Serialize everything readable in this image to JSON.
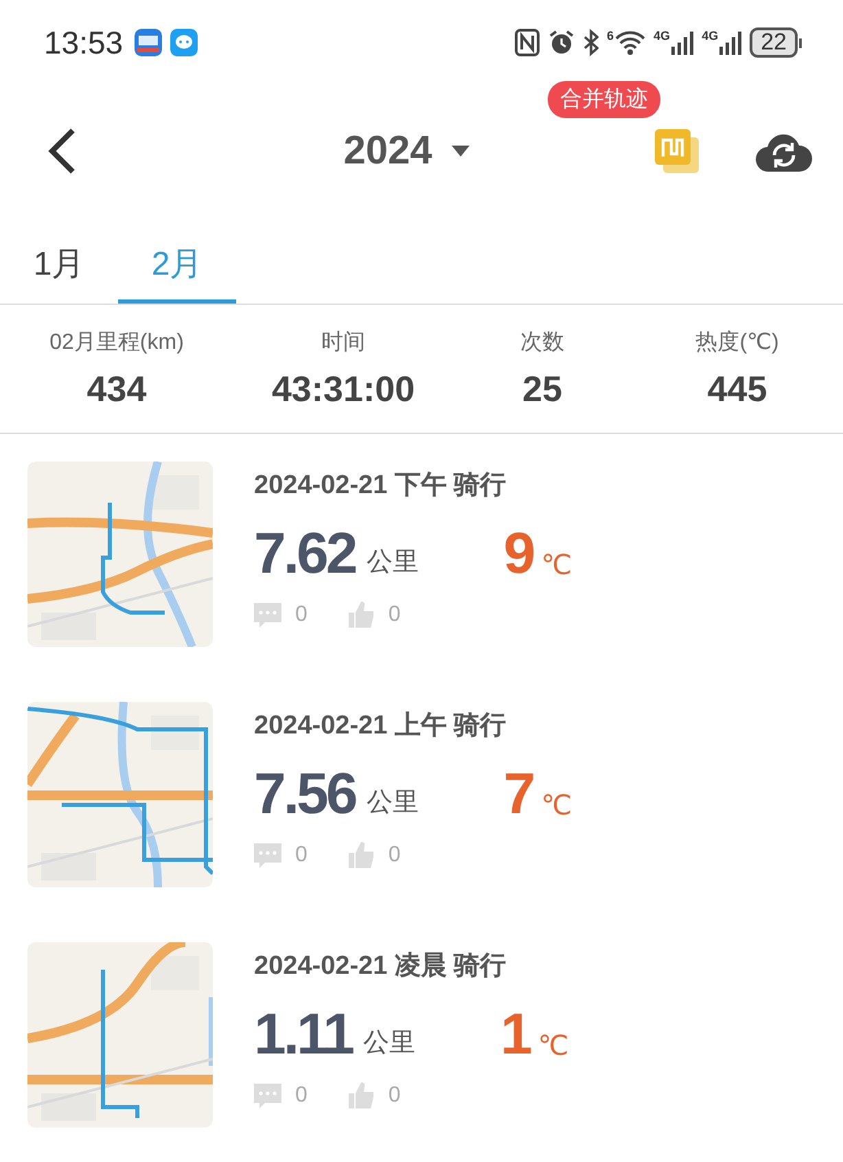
{
  "status_bar": {
    "time": "13:53",
    "wifi_label": "6",
    "network_labels": [
      "4G",
      "4G"
    ],
    "battery": "22"
  },
  "header": {
    "year": "2024",
    "merge_badge": "合并轨迹"
  },
  "tabs": [
    {
      "label": "1月",
      "selected": false
    },
    {
      "label": "2月",
      "selected": true
    }
  ],
  "stats": [
    {
      "label": "02月里程(km)",
      "value": "434"
    },
    {
      "label": "时间",
      "value": "43:31:00"
    },
    {
      "label": "次数",
      "value": "25"
    },
    {
      "label": "热度(℃)",
      "value": "445"
    }
  ],
  "rides": [
    {
      "title": "2024-02-21 下午 骑行",
      "distance": "7.62",
      "distance_unit": "公里",
      "temperature": "9",
      "temperature_unit": "℃",
      "comments": "0",
      "likes": "0"
    },
    {
      "title": "2024-02-21 上午 骑行",
      "distance": "7.56",
      "distance_unit": "公里",
      "temperature": "7",
      "temperature_unit": "℃",
      "comments": "0",
      "likes": "0"
    },
    {
      "title": "2024-02-21 凌晨 骑行",
      "distance": "1.11",
      "distance_unit": "公里",
      "temperature": "1",
      "temperature_unit": "℃",
      "comments": "0",
      "likes": "0"
    }
  ]
}
